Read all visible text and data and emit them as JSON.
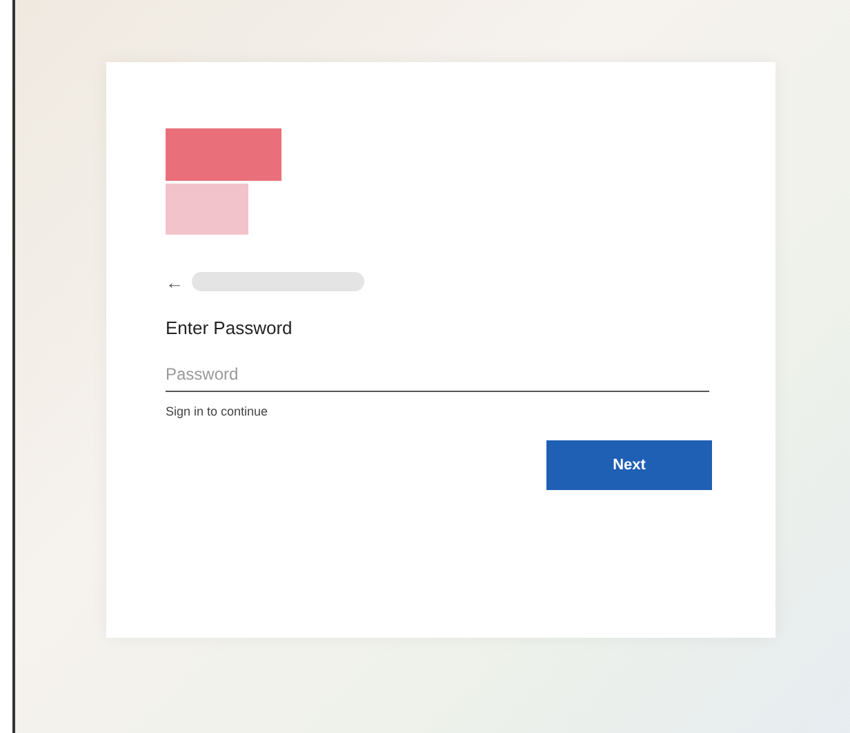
{
  "back": {
    "icon": "←"
  },
  "heading": "Enter Password",
  "password": {
    "placeholder": "Password"
  },
  "hint": "Sign in to continue",
  "buttons": [
    "Next"
  ]
}
